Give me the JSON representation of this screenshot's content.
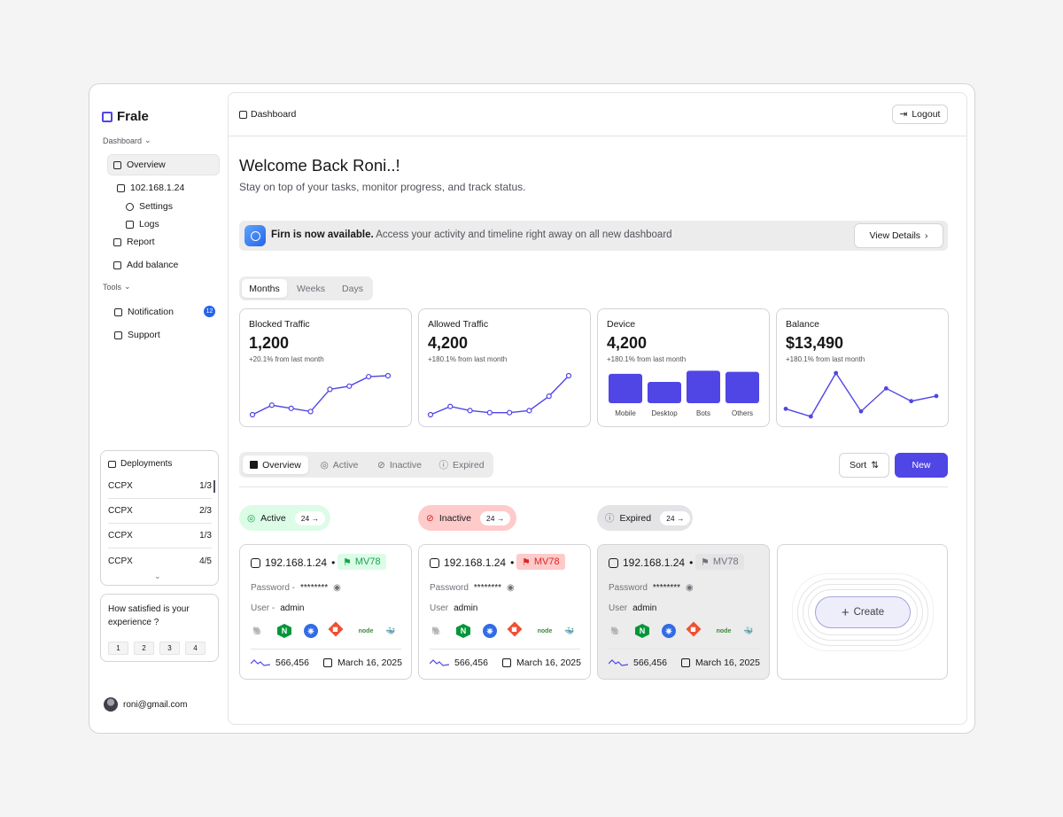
{
  "brand": {
    "name": "Frale"
  },
  "sidebar": {
    "section1": "Dashboard",
    "items": [
      {
        "label": "Overview",
        "icon": "grid-icon"
      },
      {
        "label": "102.168.1.24",
        "icon": "server-icon"
      },
      {
        "label": "Settings",
        "icon": "gear-icon"
      },
      {
        "label": "Logs",
        "icon": "image-icon"
      },
      {
        "label": "Report",
        "icon": "clipboard-icon"
      },
      {
        "label": "Add balance",
        "icon": "wallet-icon"
      }
    ],
    "section2": "Tools",
    "tools": [
      {
        "label": "Notification",
        "icon": "bell-icon",
        "badge": "12"
      },
      {
        "label": "Support",
        "icon": "chat-icon"
      }
    ],
    "deployments": {
      "title": "Deployments",
      "rows": [
        {
          "name": "CCPX",
          "value": "1/3"
        },
        {
          "name": "CCPX",
          "value": "2/3"
        },
        {
          "name": "CCPX",
          "value": "1/3"
        },
        {
          "name": "CCPX",
          "value": "4/5"
        }
      ]
    },
    "survey": {
      "question": "How satisfied is your experience ?",
      "options": [
        "1",
        "2",
        "3",
        "4"
      ]
    },
    "user": {
      "email": "roni@gmail.com"
    }
  },
  "header": {
    "breadcrumb": "Dashboard",
    "logout": "Logout"
  },
  "welcome": {
    "title": "Welcome Back Roni..!",
    "subtitle": "Stay on top of your tasks, monitor progress, and track status."
  },
  "banner": {
    "strong": "Firn is now available.",
    "text": " Access your activity and timeline right away on all new dashboard",
    "button": "View Details"
  },
  "period_tabs": [
    "Months",
    "Weeks",
    "Days"
  ],
  "cards": [
    {
      "title": "Blocked Traffic",
      "value": "1,200",
      "delta": "+20.1% from last month"
    },
    {
      "title": "Allowed Traffic",
      "value": "4,200",
      "delta": "+180.1% from last month"
    },
    {
      "title": "Device",
      "value": "4,200",
      "delta": "+180.1% from last month"
    },
    {
      "title": "Balance",
      "value": "$13,490",
      "delta": "+180.1% from last month"
    }
  ],
  "chart_data": [
    {
      "type": "line",
      "series": [
        {
          "values": [
            1,
            4,
            3,
            2,
            9,
            10,
            13,
            13.3
          ]
        }
      ]
    },
    {
      "type": "line",
      "series": [
        {
          "values": [
            1,
            5,
            3,
            2,
            2,
            3,
            10,
            20
          ]
        }
      ]
    },
    {
      "type": "bar",
      "categories": [
        "Mobile",
        "Desktop",
        "Bots",
        "Others"
      ],
      "values": [
        29,
        21,
        32,
        31
      ]
    },
    {
      "type": "line",
      "series": [
        {
          "values": [
            3,
            0,
            17,
            2,
            11,
            6,
            8
          ]
        }
      ]
    }
  ],
  "status_tabs": [
    "Overview",
    "Active",
    "Inactive",
    "Expired"
  ],
  "toolbar": {
    "sort": "Sort",
    "new": "New"
  },
  "groups": [
    {
      "label": "Active",
      "count": "24"
    },
    {
      "label": "Inactive",
      "count": "24"
    },
    {
      "label": "Expired",
      "count": "24"
    }
  ],
  "servers": [
    {
      "ip": "192.168.1.24",
      "tag": "MV78",
      "password_label": "Password -",
      "password": "********",
      "user_label": "User -",
      "user": "admin",
      "requests": "566,456",
      "date": "March 16, 2025"
    },
    {
      "ip": "192.168.1.24",
      "tag": "MV78",
      "password_label": "Password",
      "password": "********",
      "user_label": "User",
      "user": "admin",
      "requests": "566,456",
      "date": "March 16, 2025"
    },
    {
      "ip": "192.168.1.24",
      "tag": "MV78",
      "password_label": "Password",
      "password": "********",
      "user_label": "User",
      "user": "admin",
      "requests": "566,456",
      "date": "March 16, 2025"
    }
  ],
  "tech_icons": [
    "postgres-icon",
    "nginx-icon",
    "kubernetes-icon",
    "git-icon",
    "node-icon",
    "docker-icon"
  ],
  "node_label": "node",
  "create": {
    "label": "Create"
  },
  "colors": {
    "accent": "#4f46e5",
    "active": "#16a34a",
    "inactive": "#dc2626"
  }
}
